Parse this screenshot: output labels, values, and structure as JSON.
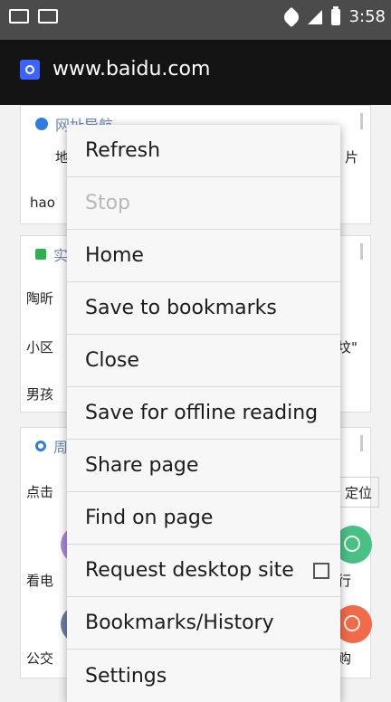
{
  "status_bar": {
    "time": "3:58",
    "icons": [
      "mail-icon",
      "chat-icon",
      "wifi-icon",
      "signal-icon",
      "battery-icon"
    ]
  },
  "url_bar": {
    "url": "www.baidu.com"
  },
  "content": {
    "card1": {
      "title": "网址导航",
      "left_text1": "地",
      "right_text1": "片",
      "left_text2": "hao"
    },
    "card2": {
      "title_short": "实",
      "row1": "陶昕",
      "row2": "小区",
      "row2_right": "坟\"",
      "row3": "男孩"
    },
    "card3": {
      "title_short": "周",
      "left_text": "点击",
      "locate_button": "定位",
      "label_left_1": "看电",
      "label_right_1": "行",
      "label_left_2": "公交",
      "label_right_2": "购"
    }
  },
  "menu": {
    "items": [
      {
        "label": "Refresh",
        "disabled": false
      },
      {
        "label": "Stop",
        "disabled": true
      },
      {
        "label": "Home",
        "disabled": false
      },
      {
        "label": "Save to bookmarks",
        "disabled": false
      },
      {
        "label": "Close",
        "disabled": false
      },
      {
        "label": "Save for offline reading",
        "disabled": false
      },
      {
        "label": "Share page",
        "disabled": false
      },
      {
        "label": "Find on page",
        "disabled": false
      },
      {
        "label": "Request desktop site",
        "disabled": false
      },
      {
        "label": "Bookmarks/History",
        "disabled": false
      },
      {
        "label": "Settings",
        "disabled": false
      }
    ]
  },
  "colors": {
    "status_bar": "#4b4b4b",
    "url_bar": "#141414",
    "menu_bg": "#f7f7f7",
    "link_blue": "#6c88b0",
    "accent_green": "#2bb24c"
  }
}
